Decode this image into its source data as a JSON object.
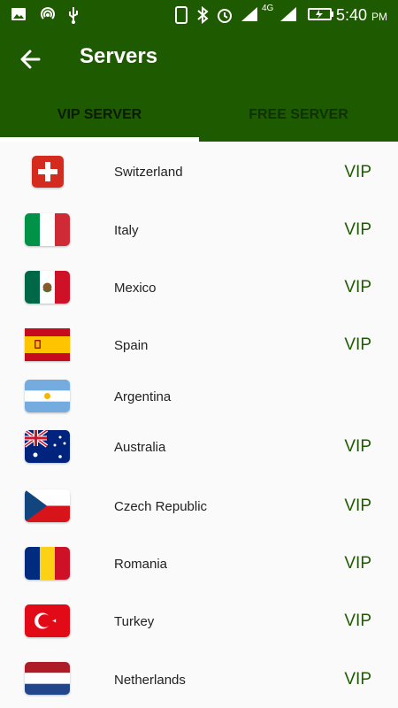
{
  "status_bar": {
    "time": "5:40",
    "ampm": "PM",
    "network": "4G",
    "icons": [
      "image-icon",
      "wifi-hotspot-icon",
      "usb-icon",
      "phone-icon",
      "bluetooth-icon",
      "alarm-icon",
      "signal-icon",
      "signal-icon-2",
      "battery-icon"
    ]
  },
  "header": {
    "title": "Servers",
    "back_icon": "arrow-left-icon"
  },
  "tabs": [
    {
      "label": "VIP SERVER",
      "active": true
    },
    {
      "label": "FREE SERVER",
      "active": false
    }
  ],
  "servers": [
    {
      "name": "Switzerland",
      "tag": "VIP"
    },
    {
      "name": "Italy",
      "tag": "VIP"
    },
    {
      "name": "Mexico",
      "tag": "VIP"
    },
    {
      "name": "Spain",
      "tag": "VIP"
    },
    {
      "name": "Argentina",
      "tag": ""
    },
    {
      "name": "Australia",
      "tag": "VIP"
    },
    {
      "name": "Czech Republic",
      "tag": "VIP"
    },
    {
      "name": "Romania",
      "tag": "VIP"
    },
    {
      "name": "Turkey",
      "tag": "VIP"
    },
    {
      "name": "Netherlands",
      "tag": "VIP"
    }
  ],
  "colors": {
    "primary": "#1e5b00",
    "vip_text": "#1e5b00",
    "background": "#fafafa"
  }
}
